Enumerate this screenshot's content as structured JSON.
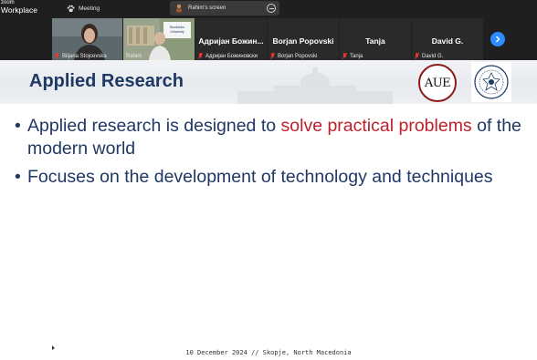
{
  "app": {
    "brand_line1": "zoom",
    "brand_line2": "Workplace",
    "meeting_label": "Meeting",
    "share_label": "Rahim's screen"
  },
  "participants": [
    {
      "display": "",
      "caption": "Biljana Stojcevska",
      "video": true
    },
    {
      "display": "",
      "caption": "Rahim",
      "video": true,
      "speaking": true
    },
    {
      "display": "Адријан Божин...",
      "caption": "Адријан Божиновски"
    },
    {
      "display": "Borjan Popovski",
      "caption": "Borjan Popovski"
    },
    {
      "display": "Tanja",
      "caption": "Tanja"
    },
    {
      "display": "David G.",
      "caption": "David G."
    }
  ],
  "slide": {
    "title": "Applied Research",
    "logo_text": "AUE",
    "bullets": [
      {
        "segments": [
          {
            "text": "Applied research is designed to ",
            "color": "#1f3864"
          },
          {
            "text": "solve practical problems",
            "color": "#c0202a"
          },
          {
            "text": " of the modern world",
            "color": "#1f3864"
          }
        ]
      },
      {
        "segments": [
          {
            "text": "Focuses on the development of technology and techniques",
            "color": "#1f3864"
          }
        ]
      }
    ],
    "footer": "10 December 2024 // Skopje, North Macedonia"
  },
  "colors": {
    "zoom_bg": "#1f1f1f",
    "accent_blue": "#2d8cff",
    "speaker_border": "#2ecc40",
    "title_navy": "#1f3864",
    "highlight_red": "#c0202a"
  }
}
